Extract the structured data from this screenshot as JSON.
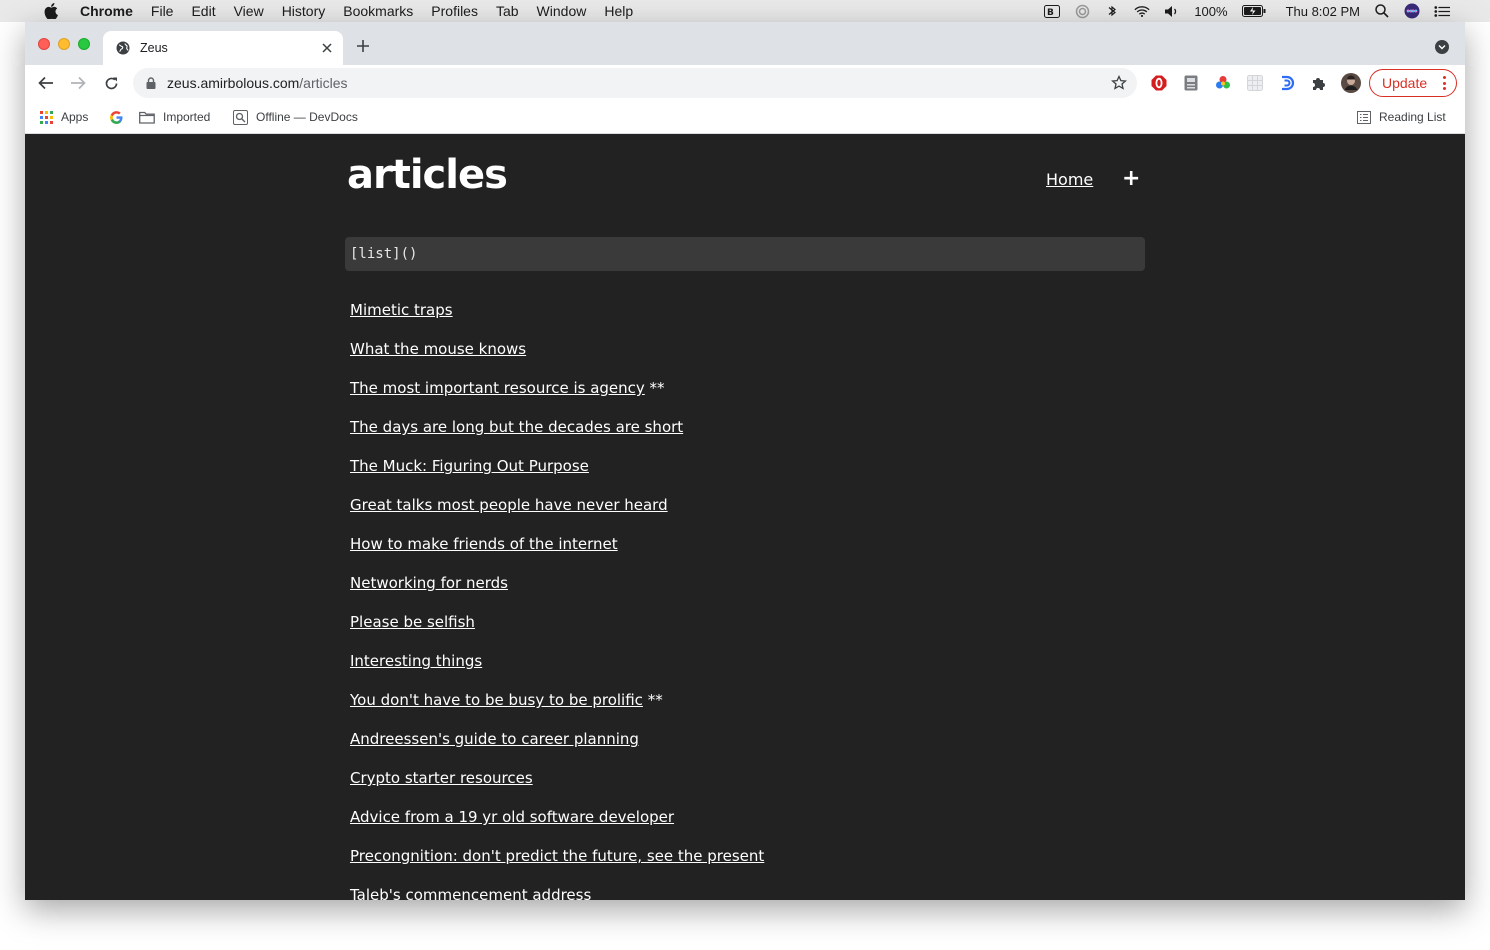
{
  "menubar": {
    "app_name": "Chrome",
    "items": [
      "File",
      "Edit",
      "View",
      "History",
      "Bookmarks",
      "Profiles",
      "Tab",
      "Window",
      "Help"
    ],
    "battery": "100%",
    "clock": "Thu 8:02 PM"
  },
  "browser": {
    "tab_title": "Zeus",
    "url_host": "zeus.amirbolous.com",
    "url_path": "/articles",
    "update_label": "Update",
    "bookmarks": [
      "Apps",
      "Imported",
      "Offline — DevDocs"
    ],
    "reading_list": "Reading List",
    "colors": {
      "tab_bg": "#dee1e6",
      "update_red": "#d93025"
    }
  },
  "page": {
    "title": "articles",
    "nav_home": "Home",
    "nav_add": "+",
    "code": "[list]()",
    "background": "#222222",
    "articles": [
      {
        "title": "Mimetic traps",
        "suffix": ""
      },
      {
        "title": "What the mouse knows",
        "suffix": ""
      },
      {
        "title": "The most important resource is agency",
        "suffix": " **"
      },
      {
        "title": "The days are long but the decades are short",
        "suffix": ""
      },
      {
        "title": "The Muck: Figuring Out Purpose",
        "suffix": ""
      },
      {
        "title": "Great talks most people have never heard",
        "suffix": ""
      },
      {
        "title": "How to make friends of the internet",
        "suffix": ""
      },
      {
        "title": "Networking for nerds",
        "suffix": ""
      },
      {
        "title": "Please be selfish",
        "suffix": ""
      },
      {
        "title": "Interesting things",
        "suffix": ""
      },
      {
        "title": "You don't have to be busy to be prolific",
        "suffix": " **"
      },
      {
        "title": "Andreessen's guide to career planning",
        "suffix": ""
      },
      {
        "title": "Crypto starter resources",
        "suffix": ""
      },
      {
        "title": "Advice from a 19 yr old software developer",
        "suffix": ""
      },
      {
        "title": "Precongnition: don't predict the future, see the present",
        "suffix": ""
      },
      {
        "title": "Taleb's commencement address",
        "suffix": ""
      }
    ]
  }
}
